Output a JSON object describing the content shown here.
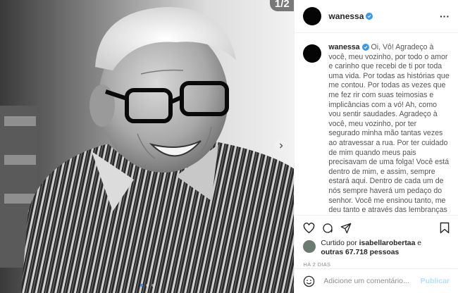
{
  "media": {
    "counter": "1/2",
    "dot_count": 3,
    "active_dot": 0,
    "next_icon": "chevron-right-icon"
  },
  "header": {
    "username": "wanessa",
    "verified_icon": "verified-badge-icon",
    "more_icon": "more-horizontal-icon",
    "more_label": "···"
  },
  "caption": {
    "username": "wanessa",
    "text": "Oi, Vô! Agradeço à você, meu vozinho, por todo o amor e carinho que recebi de ti por toda uma vida. Por todas as histórias que me contou. Por todas as vezes que me fez rir com suas teimosias e implicâncias com a vó! Ah, como vou sentir saudades. Agradeço à você, meu vozinho, por ter segurado minha mão tantas vezes ao atravessar a rua. Por ter cuidado de mim quando meus pais precisavam de uma folga! Você está dentro de mim, e assim, sempre estará aqui. Dentro de cada um de nós sempre haverá um pedaço do senhor. Você me ensinou tanto, me deu tanto e através das lembranças doces e amorosas eu me sustento nessa existência. Te amo, seu Geraldo."
  },
  "actions": {
    "like_icon": "heart-icon",
    "comment_icon": "comment-bubble-icon",
    "share_icon": "paper-plane-icon",
    "save_icon": "bookmark-icon"
  },
  "likes": {
    "prefix": "Curtido por",
    "user": "isabellarobertaa",
    "conj": "e",
    "others": "outras 67.718 pessoas"
  },
  "timestamp": "HÁ 2 DIAS",
  "comment_box": {
    "emoji_icon": "smiley-icon",
    "placeholder": "Adicione um comentário...",
    "submit_label": "Publicar"
  },
  "colors": {
    "verified": "#3897f0",
    "publish_disabled": "#b2dffc",
    "secondary_text": "#8e8e8e"
  }
}
